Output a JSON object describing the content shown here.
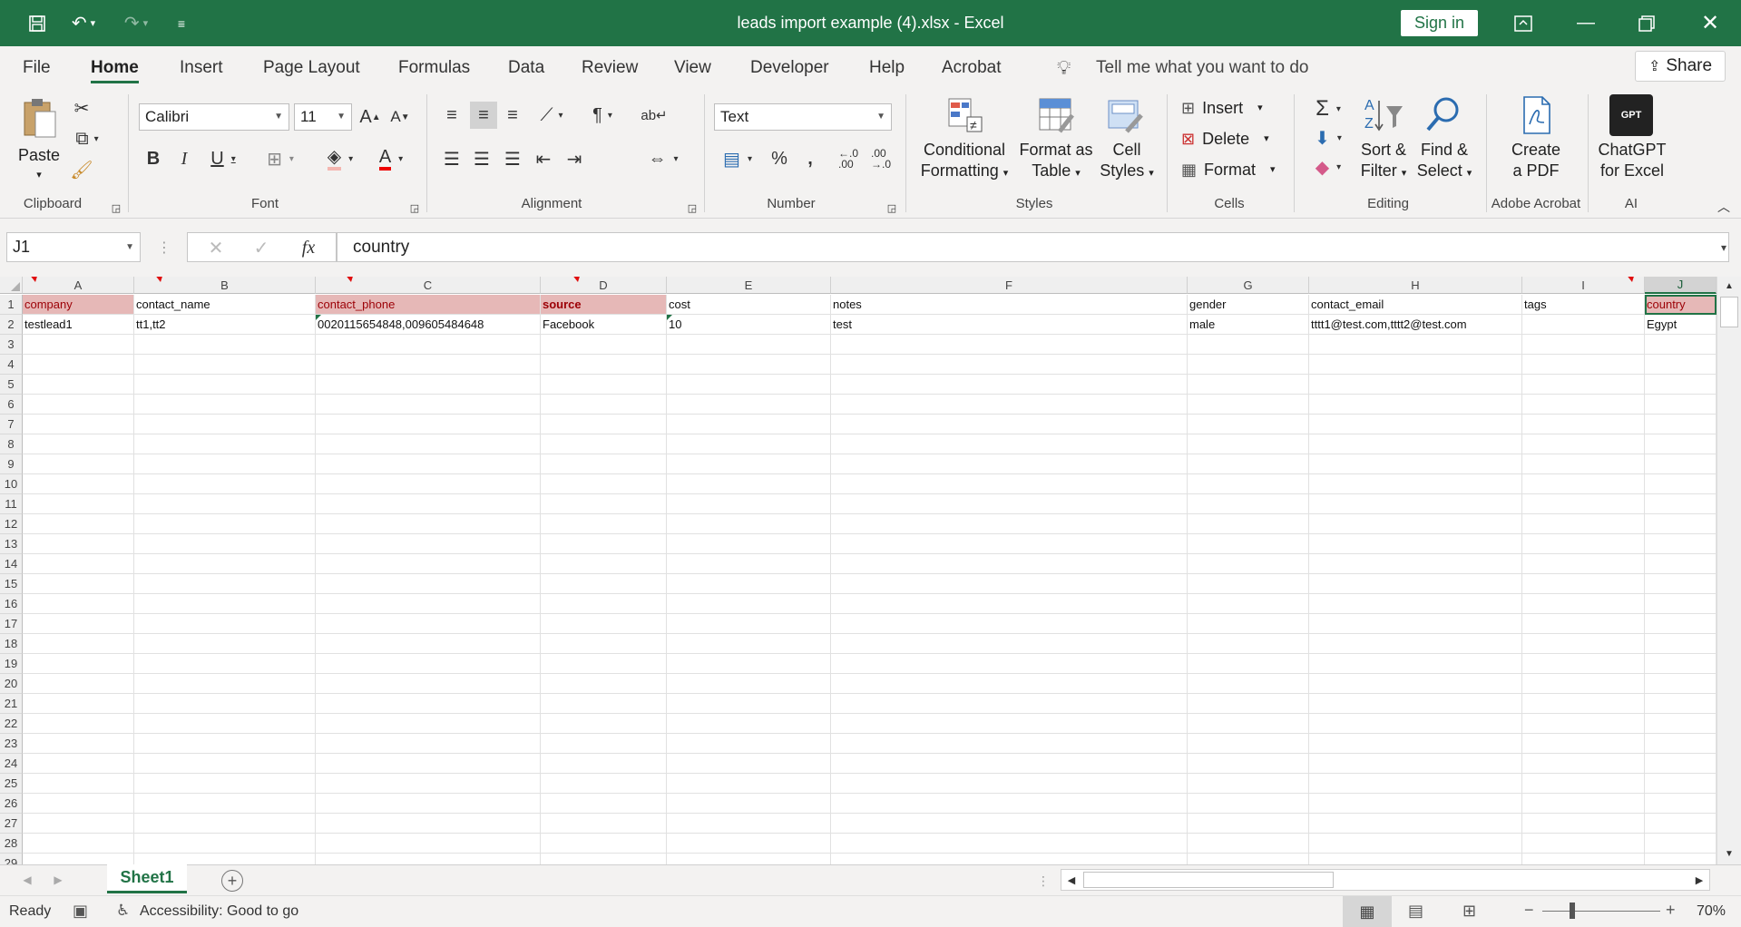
{
  "window": {
    "title": "leads import example (4).xlsx  -  Excel",
    "sign_in": "Sign in",
    "theme_color": "#217346"
  },
  "tabs": [
    "File",
    "Home",
    "Insert",
    "Page Layout",
    "Formulas",
    "Data",
    "Review",
    "View",
    "Developer",
    "Help",
    "Acrobat"
  ],
  "tell_me": "Tell me what you want to do",
  "share": "Share",
  "ribbon": {
    "clipboard": {
      "paste": "Paste",
      "label": "Clipboard"
    },
    "font": {
      "name": "Calibri",
      "size": "11",
      "label": "Font"
    },
    "alignment": {
      "label": "Alignment"
    },
    "number": {
      "format": "Text",
      "label": "Number"
    },
    "styles": {
      "conditional_1": "Conditional",
      "conditional_2": "Formatting",
      "format_table_1": "Format as",
      "format_table_2": "Table",
      "cell_styles_1": "Cell",
      "cell_styles_2": "Styles",
      "label": "Styles"
    },
    "cells": {
      "insert": "Insert",
      "delete": "Delete",
      "format": "Format",
      "label": "Cells"
    },
    "editing": {
      "sort_1": "Sort &",
      "sort_2": "Filter",
      "find_1": "Find &",
      "find_2": "Select",
      "label": "Editing"
    },
    "acrobat": {
      "create_1": "Create",
      "create_2": "a PDF",
      "label": "Adobe Acrobat"
    },
    "ai": {
      "chatgpt_1": "ChatGPT",
      "chatgpt_2": "for Excel",
      "label": "AI",
      "logo_text": "GPT"
    }
  },
  "formula_bar": {
    "name_box": "J1",
    "fx": "fx",
    "formula": "country"
  },
  "grid": {
    "columns": [
      "A",
      "B",
      "C",
      "D",
      "E",
      "F",
      "G",
      "H",
      "I",
      "J"
    ],
    "selected_column": "J",
    "row_count": 29,
    "rows": [
      [
        "company",
        "contact_name",
        "contact_phone",
        "source",
        "cost",
        "notes",
        "gender",
        "contact_email",
        "tags",
        "country"
      ],
      [
        "testlead1",
        "tt1,tt2",
        "0020115654848,009605484648",
        "Facebook",
        "10",
        "test",
        "male",
        "tttt1@test.com,tttt2@test.com",
        "",
        "Egypt"
      ]
    ],
    "highlight_color": "#e6b8b7",
    "highlighted_header_columns": [
      "A",
      "C",
      "D",
      "J"
    ]
  },
  "sheets": [
    "Sheet1"
  ],
  "status": {
    "ready": "Ready",
    "accessibility": "Accessibility: Good to go",
    "zoom": "70%"
  }
}
